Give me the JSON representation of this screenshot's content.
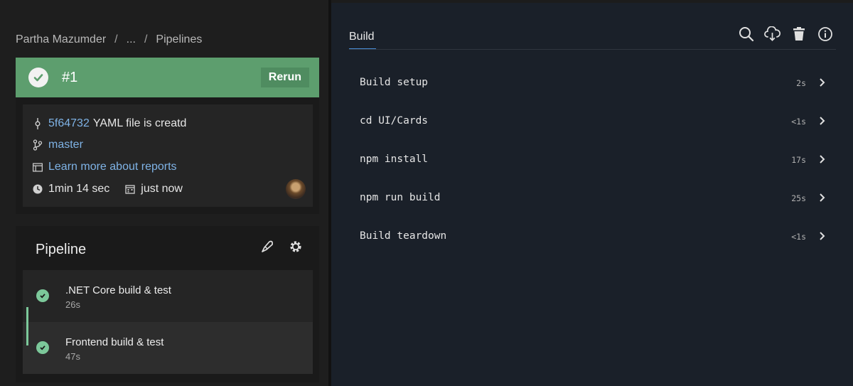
{
  "breadcrumb": [
    "Partha Mazumder",
    "...",
    "Pipelines"
  ],
  "run": {
    "number": "#1",
    "rerun_label": "Rerun",
    "commit_hash": "5f64732",
    "commit_message": "YAML file is creatd",
    "branch": "master",
    "reports_link": "Learn more about reports",
    "duration": "1min 14 sec",
    "when": "just now",
    "status_color": "#5d9e6e"
  },
  "pipeline": {
    "title": "Pipeline",
    "jobs": [
      {
        "name": ".NET Core build & test",
        "duration": "26s"
      },
      {
        "name": "Frontend build & test",
        "duration": "47s"
      }
    ]
  },
  "build": {
    "tab_label": "Build",
    "icons": [
      "search-icon",
      "cloud-download-icon",
      "trash-icon",
      "info-icon"
    ],
    "steps": [
      {
        "name": "Build setup",
        "duration": "2s"
      },
      {
        "name": "cd UI/Cards",
        "duration": "<1s"
      },
      {
        "name": "npm install",
        "duration": "17s"
      },
      {
        "name": "npm run build",
        "duration": "25s"
      },
      {
        "name": "Build teardown",
        "duration": "<1s"
      }
    ]
  }
}
